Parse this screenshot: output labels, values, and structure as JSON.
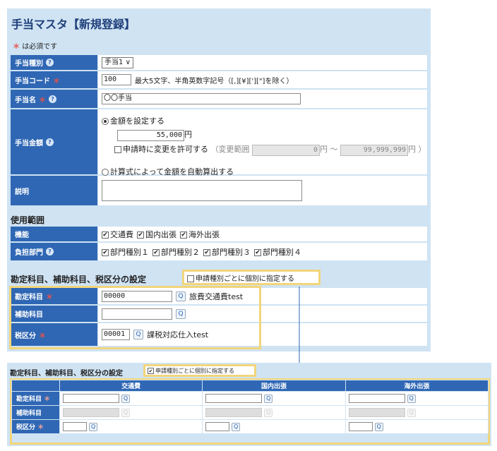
{
  "title": "手当マスタ【新規登録】",
  "req_note_mark": "＊",
  "req_note": "は必須です",
  "req_mark": "＊",
  "help_glyph": "?",
  "search_glyph": "Q",
  "check_glyph": "✔",
  "range_sep": "～",
  "select_arrow": "∨",
  "fields": {
    "type_label": "手当種別",
    "type_value": "手当1",
    "code_label": "手当コード",
    "code_value": "100",
    "code_hint": "最大5文字、半角英数字記号（[,][¥]['][\"]を除く）",
    "name_label": "手当名",
    "name_value": "〇〇手当",
    "amount_label": "手当金額",
    "amount_opt1": "金額を設定する",
    "amount_value": "55,000",
    "yen": "円",
    "allow_change": "申請時に変更を許可する",
    "range_open": "（変更範囲",
    "range_min": "0",
    "range_max": "99,999,999",
    "range_close": "円 ）",
    "amount_opt2": "計算式によって金額を自動算出する",
    "desc_label": "説明"
  },
  "usage": {
    "section": "使用範囲",
    "func_label": "機能",
    "funcs": [
      "交通費",
      "国内出張",
      "海外出張"
    ],
    "dept_label": "負担部門",
    "depts": [
      "部門種別１",
      "部門種別２",
      "部門種別３",
      "部門種別４"
    ]
  },
  "account": {
    "section": "勘定科目、補助科目、税区分の設定",
    "per_type": "申請種別ごとに個別に指定する",
    "acct_label": "勘定科目",
    "acct_code": "00000",
    "acct_name": "旅費交通費test",
    "sub_label": "補助科目",
    "tax_label": "税区分",
    "tax_code": "00001",
    "tax_name": "課税対応仕入test"
  },
  "table": {
    "section": "勘定科目、補助科目、税区分の設定",
    "per_type": "申請種別ごとに個別に指定する",
    "cols": [
      "交通費",
      "国内出張",
      "海外出張"
    ],
    "rows": [
      "勘定科目",
      "補助科目",
      "税区分"
    ]
  }
}
